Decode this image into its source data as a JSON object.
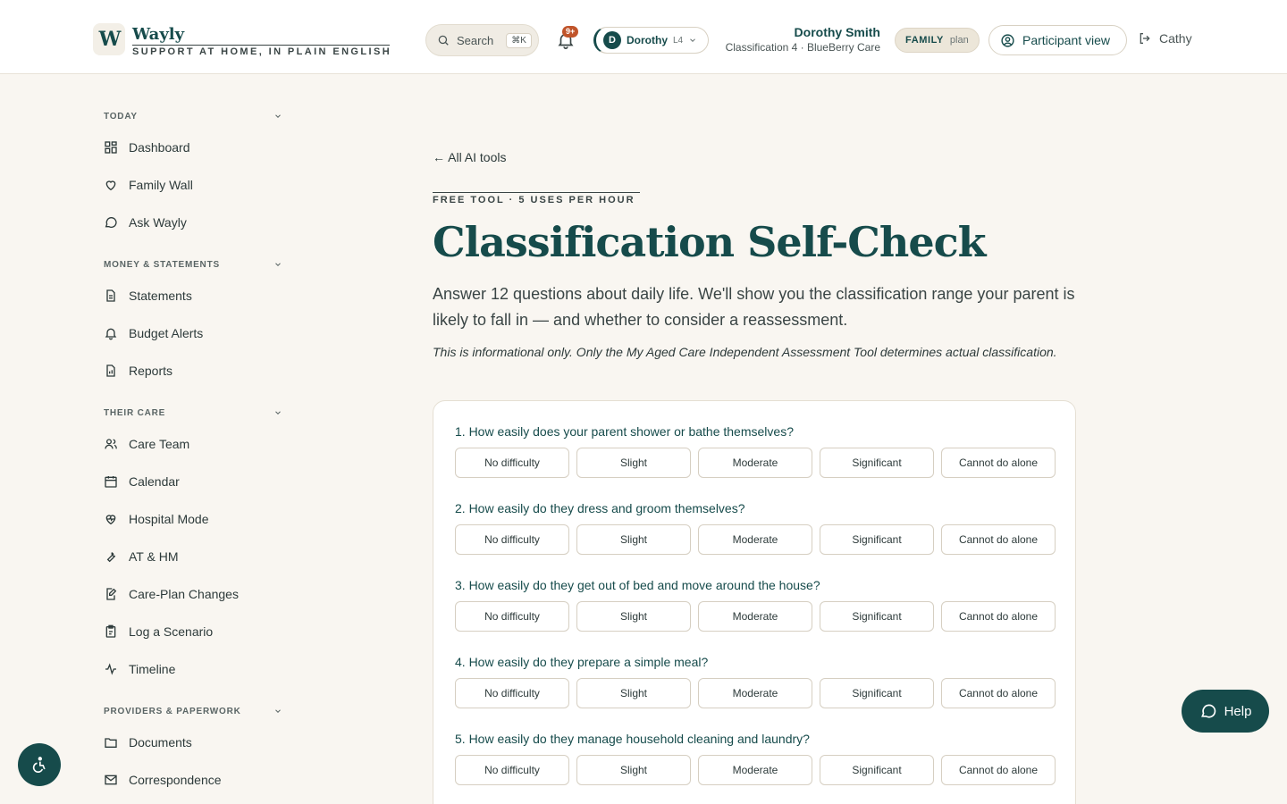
{
  "header": {
    "logo_mark": "W",
    "app_name": "Wayly",
    "tagline": "SUPPORT AT HOME, IN PLAIN ENGLISH",
    "search_label": "Search",
    "search_shortcut": "⌘K",
    "notification_count": "9+",
    "participant": {
      "initial": "D",
      "name": "Dorothy",
      "level": "L4"
    },
    "user_name": "Dorothy Smith",
    "user_sub": "Classification 4 · BlueBerry Care",
    "plan_family": "FAMILY",
    "plan_word": "plan",
    "participant_view": "Participant view",
    "logout_name": "Cathy"
  },
  "sidebar": {
    "sections": [
      {
        "title": "TODAY",
        "items": [
          "Dashboard",
          "Family Wall",
          "Ask Wayly"
        ]
      },
      {
        "title": "MONEY & STATEMENTS",
        "items": [
          "Statements",
          "Budget Alerts",
          "Reports"
        ]
      },
      {
        "title": "THEIR CARE",
        "items": [
          "Care Team",
          "Calendar",
          "Hospital Mode",
          "AT & HM",
          "Care-Plan Changes",
          "Log a Scenario",
          "Timeline"
        ]
      },
      {
        "title": "PROVIDERS & PAPERWORK",
        "items": [
          "Documents",
          "Correspondence"
        ]
      }
    ]
  },
  "main": {
    "back_link": "← All AI tools",
    "eyebrow": "FREE TOOL · 5 USES PER HOUR",
    "title": "Classification Self-Check",
    "lead": "Answer 12 questions about daily life. We'll show you the classification range your parent is likely to fall in — and whether to consider a reassessment.",
    "note": "This is informational only. Only the My Aged Care Independent Assessment Tool determines actual classification.",
    "options": [
      "No difficulty",
      "Slight",
      "Moderate",
      "Significant",
      "Cannot do alone"
    ],
    "questions": [
      "1. How easily does your parent shower or bathe themselves?",
      "2. How easily do they dress and groom themselves?",
      "3. How easily do they get out of bed and move around the house?",
      "4. How easily do they prepare a simple meal?",
      "5. How easily do they manage household cleaning and laundry?"
    ]
  },
  "floating": {
    "help_label": "Help"
  },
  "colors": {
    "brand": "#164b4b",
    "badge": "#c0542a",
    "background": "#f9f6f1"
  }
}
